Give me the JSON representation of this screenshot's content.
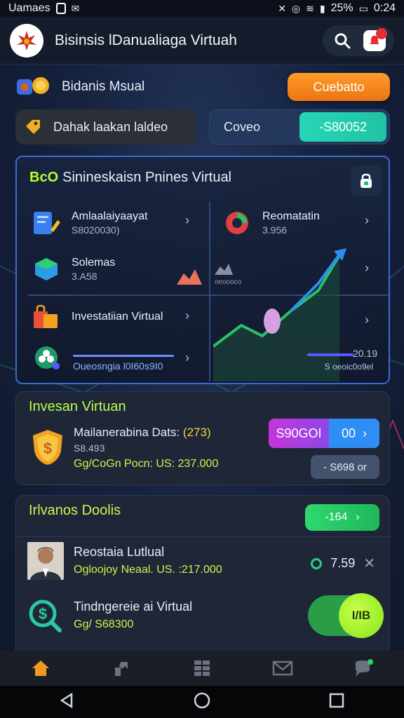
{
  "status_bar": {
    "carrier": "Uamaes",
    "battery": "25%",
    "time": "0:24"
  },
  "header": {
    "title": "Bisinsis lDanualiaga Virtuah"
  },
  "row1": {
    "label": "Bidanis Msual",
    "button": "Cuebatto"
  },
  "row2": {
    "left_label": "Dahak laakan laldeo",
    "balance_label": "Coveo",
    "balance_value": "-S80052"
  },
  "panel": {
    "badge": "BcO",
    "title": "Sinineskaisn Pnines Virtual",
    "items": [
      {
        "label": "Amlaalaiyaayat",
        "sub": "S8020030)"
      },
      {
        "label": "Reomatatin",
        "sub": "3.956"
      },
      {
        "label": "Solemas",
        "sub": "3.A58"
      },
      {
        "label": "Investatiian Virtual",
        "sub": ""
      },
      {
        "label": "Oueosngia l0I60s9I0",
        "sub": ""
      }
    ],
    "chart_tag": "oeoooco",
    "mini_value": "20.19",
    "mini_caption": "S oeoic0o9el"
  },
  "invest": {
    "title": "Invesan Virtuan",
    "line1": "Mailanerabina Dats: ",
    "line1_highlight": "(273)",
    "line2": "S8.493",
    "line3": "Gg/CoGn Pocn: US: 237.000",
    "button_left": "S90GOI",
    "button_right": "00",
    "secondary": "- S698 or"
  },
  "tools": {
    "title": "Irlvanos Doolis",
    "pill": "-164",
    "row1": {
      "title": "Reostaia Lutlual",
      "sub": "Ogloojoy Neaal. US. :217.000",
      "value": "7.59"
    },
    "row2": {
      "title": "Tindngereie ai Virtual",
      "sub": "Gg/ S68300",
      "toggle": "I/IB"
    }
  },
  "colors": {
    "accent_orange": "#ef7f1a",
    "accent_teal": "#22cdb0",
    "accent_lime": "#b6ff2b",
    "panel_border": "#3b6bd1"
  }
}
